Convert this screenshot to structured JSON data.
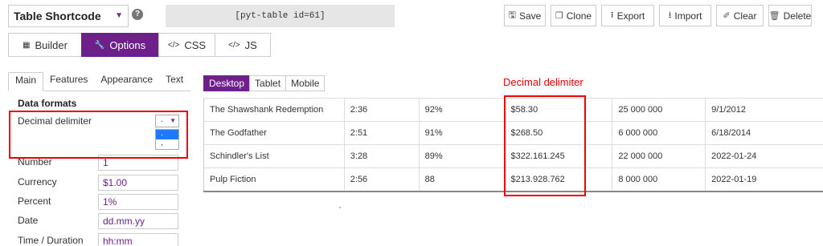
{
  "header": {
    "table_select": "Table Shortcode",
    "help": "?",
    "shortcode": "[pyt-table id=61]"
  },
  "actions": [
    {
      "icon": "save-icon",
      "glyph": "🖫",
      "label": "Save"
    },
    {
      "icon": "clone-icon",
      "glyph": "❐",
      "label": "Clone"
    },
    {
      "icon": "export-icon",
      "glyph": "⭱",
      "label": "Export"
    },
    {
      "icon": "import-icon",
      "glyph": "⭳",
      "label": "Import"
    },
    {
      "icon": "eraser-icon",
      "glyph": "✐",
      "label": "Clear"
    },
    {
      "icon": "trash-icon",
      "glyph": "🗑",
      "label": "Delete"
    }
  ],
  "main_tabs": [
    {
      "icon": "grid-icon",
      "glyph": "▦",
      "label": "Builder",
      "active": false
    },
    {
      "icon": "wrench-icon",
      "glyph": "🔧",
      "label": "Options",
      "active": true
    },
    {
      "icon": "code-icon",
      "glyph": "</>",
      "label": "CSS",
      "active": false
    },
    {
      "icon": "code-icon",
      "glyph": "</>",
      "label": "JS",
      "active": false
    }
  ],
  "sub_tabs": [
    {
      "label": "Main",
      "active": true
    },
    {
      "label": "Features",
      "active": false
    },
    {
      "label": "Appearance",
      "active": false
    },
    {
      "label": "Text",
      "active": false
    }
  ],
  "data_formats": {
    "title": "Data formats",
    "decimal_label": "Decimal delimiter",
    "decimal_value": ".",
    "decimal_options": [
      ".",
      ","
    ],
    "fields": [
      {
        "label": "Number",
        "value": "1"
      },
      {
        "label": "Currency",
        "value": "$1.00"
      },
      {
        "label": "Percent",
        "value": "1%"
      },
      {
        "label": "Date",
        "value": "dd.mm.yy"
      },
      {
        "label": "Time / Duration",
        "value": "hh:mm"
      }
    ]
  },
  "device_tabs": [
    {
      "label": "Desktop",
      "active": true
    },
    {
      "label": "Tablet",
      "active": false
    },
    {
      "label": "Mobile",
      "active": false
    }
  ],
  "annotation": "Decimal delimiter",
  "table": {
    "rows": [
      [
        "The Shawshank Redemption",
        "2:36",
        "92%",
        "$58.30",
        "25 000 000",
        "9/1/2012"
      ],
      [
        "The Godfather",
        "2:51",
        "91%",
        "$268.50",
        "6 000 000",
        "6/18/2014"
      ],
      [
        "Schindler's List",
        "3:28",
        "89%",
        "$322.161.245",
        "22 000 000",
        "2022-01-24"
      ],
      [
        "Pulp Fiction",
        "2:56",
        "88",
        "$213.928.762",
        "8 000 000",
        "2022-01-19"
      ]
    ]
  },
  "colors": {
    "accent": "#6d1f8a",
    "annotation": "#e00000"
  }
}
